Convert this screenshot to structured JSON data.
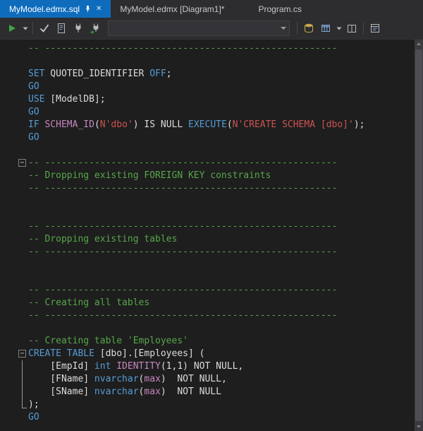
{
  "colors": {
    "keyword": "#569cd6",
    "comment": "#57a64a",
    "string": "#ce5252",
    "function": "#c586c0",
    "plain": "#dcdcdc",
    "editor_bg": "#1e1e1e",
    "chrome_bg": "#2d2d30",
    "active_tab_bg": "#0f6cbd",
    "accent_green": "#3ea843"
  },
  "tabbar": {
    "close_glyph": "✕",
    "tabs": [
      {
        "label": "MyModel.edmx.sql",
        "state": "active",
        "pinned": true
      },
      {
        "label": "MyModel.edmx [Diagram1]*",
        "state": "inactive"
      },
      {
        "label": "Program.cs",
        "state": "inactive"
      }
    ]
  },
  "toolbar": {
    "database_combobox": {
      "value": "",
      "placeholder": ""
    },
    "icons": [
      {
        "name": "execute-icon",
        "glyph": "green-play-triangle"
      },
      {
        "name": "execute-options-icon",
        "glyph": "caret-down"
      },
      {
        "name": "parse-icon",
        "glyph": "checkmark"
      },
      {
        "name": "code-analysis-icon",
        "glyph": "script-document"
      },
      {
        "name": "disconnect-icon",
        "glyph": "plug"
      },
      {
        "name": "change-connection-icon",
        "glyph": "plug-with-arrow"
      },
      {
        "name": "estimated-plan-icon",
        "glyph": "database-cylinder"
      },
      {
        "name": "results-to-grid-icon",
        "glyph": "grid"
      },
      {
        "name": "results-options-icon",
        "glyph": "caret-down"
      },
      {
        "name": "split-pane-icon",
        "glyph": "split-window"
      },
      {
        "name": "query-options-icon",
        "glyph": "options-window"
      },
      {
        "name": "pin-icon",
        "glyph": "pushpin"
      },
      {
        "name": "close-icon",
        "glyph": "✕"
      }
    ]
  },
  "code": {
    "fold_glyph": "−",
    "lines": [
      {
        "fold": null,
        "segs": [
          [
            "cm",
            "-- -----------------------------------------------------"
          ]
        ]
      },
      {
        "fold": null,
        "segs": []
      },
      {
        "fold": null,
        "segs": [
          [
            "kw",
            "SET"
          ],
          [
            "pl",
            " QUOTED_IDENTIFIER "
          ],
          [
            "kw",
            "OFF"
          ],
          [
            "pl",
            ";"
          ]
        ]
      },
      {
        "fold": null,
        "segs": [
          [
            "kw",
            "GO"
          ]
        ]
      },
      {
        "fold": null,
        "segs": [
          [
            "kw",
            "USE"
          ],
          [
            "pl",
            " [ModelDB];"
          ]
        ]
      },
      {
        "fold": null,
        "segs": [
          [
            "kw",
            "GO"
          ]
        ]
      },
      {
        "fold": null,
        "segs": [
          [
            "kw",
            "IF"
          ],
          [
            "pl",
            " "
          ],
          [
            "fn",
            "SCHEMA_ID"
          ],
          [
            "pl",
            "("
          ],
          [
            "st",
            "N'dbo'"
          ],
          [
            "pl",
            ") IS NULL "
          ],
          [
            "kw",
            "EXECUTE"
          ],
          [
            "pl",
            "("
          ],
          [
            "st",
            "N'CREATE SCHEMA [dbo]'"
          ],
          [
            "pl",
            ");"
          ]
        ]
      },
      {
        "fold": null,
        "segs": [
          [
            "kw",
            "GO"
          ]
        ]
      },
      {
        "fold": null,
        "segs": []
      },
      {
        "fold": "start",
        "segs": [
          [
            "cm",
            "-- -----------------------------------------------------"
          ]
        ]
      },
      {
        "fold": null,
        "segs": [
          [
            "cm",
            "-- Dropping existing FOREIGN KEY constraints"
          ]
        ]
      },
      {
        "fold": null,
        "segs": [
          [
            "cm",
            "-- -----------------------------------------------------"
          ]
        ]
      },
      {
        "fold": null,
        "segs": []
      },
      {
        "fold": null,
        "segs": []
      },
      {
        "fold": null,
        "segs": [
          [
            "cm",
            "-- -----------------------------------------------------"
          ]
        ]
      },
      {
        "fold": null,
        "segs": [
          [
            "cm",
            "-- Dropping existing tables"
          ]
        ]
      },
      {
        "fold": null,
        "segs": [
          [
            "cm",
            "-- -----------------------------------------------------"
          ]
        ]
      },
      {
        "fold": null,
        "segs": []
      },
      {
        "fold": null,
        "segs": []
      },
      {
        "fold": null,
        "segs": [
          [
            "cm",
            "-- -----------------------------------------------------"
          ]
        ]
      },
      {
        "fold": null,
        "segs": [
          [
            "cm",
            "-- Creating all tables"
          ]
        ]
      },
      {
        "fold": null,
        "segs": [
          [
            "cm",
            "-- -----------------------------------------------------"
          ]
        ]
      },
      {
        "fold": null,
        "segs": []
      },
      {
        "fold": null,
        "segs": [
          [
            "cm",
            "-- Creating table 'Employees'"
          ]
        ]
      },
      {
        "fold": "start",
        "segs": [
          [
            "kw",
            "CREATE TABLE"
          ],
          [
            "pl",
            " [dbo].[Employees] ("
          ]
        ]
      },
      {
        "fold": "mid",
        "segs": [
          [
            "pl",
            "    [EmpId] "
          ],
          [
            "kw",
            "int"
          ],
          [
            "pl",
            " "
          ],
          [
            "fn",
            "IDENTITY"
          ],
          [
            "pl",
            "(1,1) NOT NULL,"
          ]
        ]
      },
      {
        "fold": "mid",
        "segs": [
          [
            "pl",
            "    [FName] "
          ],
          [
            "kw",
            "nvarchar"
          ],
          [
            "pl",
            "("
          ],
          [
            "fn",
            "max"
          ],
          [
            "pl",
            ")  NOT NULL,"
          ]
        ]
      },
      {
        "fold": "mid",
        "segs": [
          [
            "pl",
            "    [SName] "
          ],
          [
            "kw",
            "nvarchar"
          ],
          [
            "pl",
            "("
          ],
          [
            "fn",
            "max"
          ],
          [
            "pl",
            ")  NOT NULL"
          ]
        ]
      },
      {
        "fold": "end",
        "segs": [
          [
            "pl",
            ");"
          ]
        ]
      },
      {
        "fold": null,
        "segs": [
          [
            "kw",
            "GO"
          ]
        ]
      }
    ]
  }
}
